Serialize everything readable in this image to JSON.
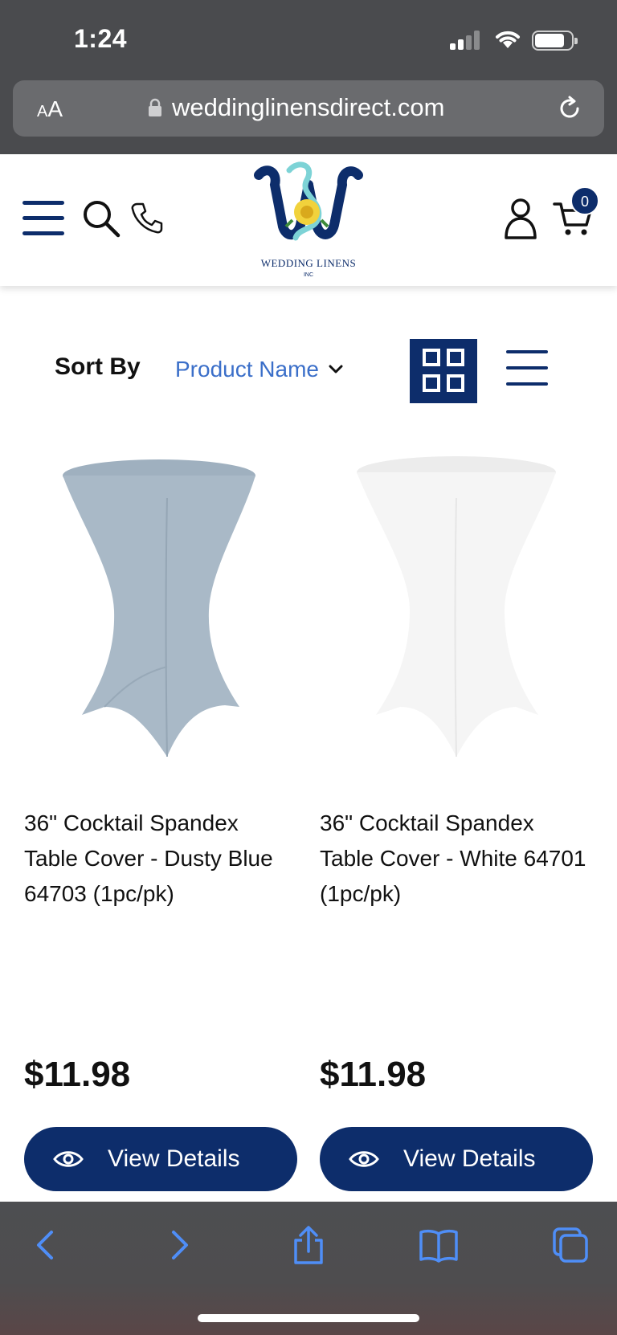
{
  "status_bar": {
    "time": "1:24"
  },
  "browser": {
    "text_size_label_small": "A",
    "text_size_label_large": "A",
    "url": "weddinglinensdirect.com"
  },
  "header": {
    "logo_text": "WEDDING LINENS",
    "logo_subtext": "INC",
    "cart_count": "0"
  },
  "sort": {
    "label": "Sort By",
    "selected": "Product Name"
  },
  "products": [
    {
      "title": "36\" Cocktail Spandex Table Cover - Dusty Blue 64703 (1pc/pk)",
      "price": "$11.98",
      "button_label": "View Details",
      "color": "#a9b9c7"
    },
    {
      "title": "36\" Cocktail Spandex Table Cover - White 64701 (1pc/pk)",
      "price": "$11.98",
      "button_label": "View Details",
      "color": "#f4f4f4"
    }
  ],
  "colors": {
    "brand": "#0d2d6b",
    "link": "#3b6fc9",
    "chrome": "#4a4b4e",
    "toolbar_icon": "#4f8ef7"
  }
}
